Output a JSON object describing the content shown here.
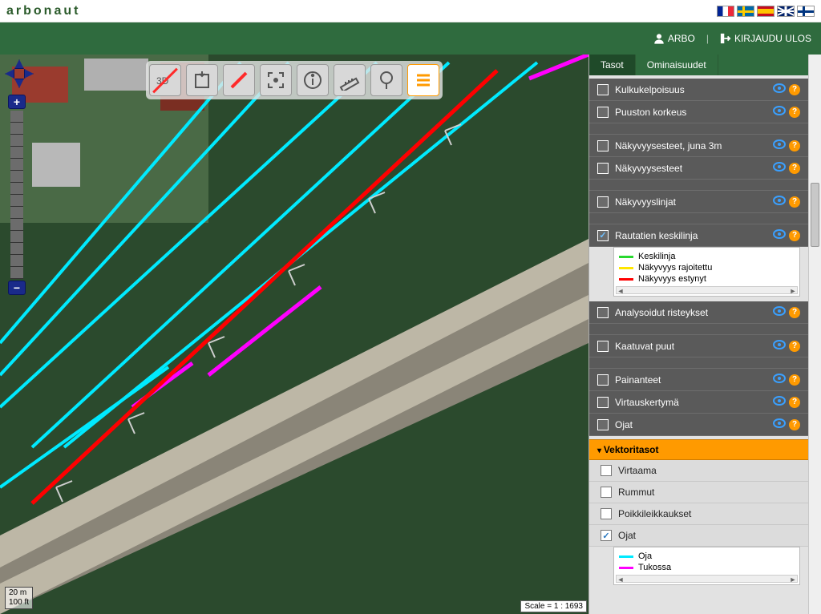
{
  "brand": "arbonaut",
  "header": {
    "user": "ARBO",
    "logout": "KIRJAUDU ULOS"
  },
  "tabs": {
    "layers": "Tasot",
    "properties": "Ominaisuudet"
  },
  "toolbar": {
    "btn3d": "3D",
    "pdf": "PDF"
  },
  "zoom": {
    "in": "+",
    "out": "−"
  },
  "layers": [
    {
      "id": "kulku",
      "label": "Kulkukelpoisuus",
      "checked": false
    },
    {
      "id": "pkork",
      "label": "Puuston korkeus",
      "checked": false
    },
    {
      "id": "nkj3",
      "label": "Näkyvyysesteet, juna 3m",
      "checked": false
    },
    {
      "id": "nke",
      "label": "Näkyvyysesteet",
      "checked": false
    },
    {
      "id": "nkl",
      "label": "Näkyvyyslinjat",
      "checked": false
    },
    {
      "id": "raut",
      "label": "Rautatien keskilinja",
      "checked": true,
      "legend": [
        {
          "color": "#29d92f",
          "label": "Keskilinja"
        },
        {
          "color": "#ffe600",
          "label": "Näkyvyys rajoitettu"
        },
        {
          "color": "#ff0000",
          "label": "Näkyvyys estynyt"
        }
      ]
    },
    {
      "id": "arist",
      "label": "Analysoidut risteykset",
      "checked": false
    },
    {
      "id": "kpuut",
      "label": "Kaatuvat puut",
      "checked": false
    },
    {
      "id": "paint",
      "label": "Painanteet",
      "checked": false
    },
    {
      "id": "virtk",
      "label": "Virtauskertymä",
      "checked": false
    },
    {
      "id": "ojat",
      "label": "Ojat",
      "checked": false
    }
  ],
  "vector_header": "Vektoritasot",
  "vector_layers": [
    {
      "id": "virtaama",
      "label": "Virtaama",
      "checked": false
    },
    {
      "id": "rummut",
      "label": "Rummut",
      "checked": false
    },
    {
      "id": "poikki",
      "label": "Poikkileikkaukset",
      "checked": false
    },
    {
      "id": "vojat",
      "label": "Ojat",
      "checked": true,
      "legend": [
        {
          "color": "#00eaff",
          "label": "Oja"
        },
        {
          "color": "#ff00ff",
          "label": "Tukossa"
        }
      ]
    }
  ],
  "scalebar": {
    "m": "20 m",
    "ft": "100 ft"
  },
  "scale_text": "Scale = 1 : 1693",
  "flags": [
    "fr",
    "se",
    "es",
    "uk",
    "fi"
  ],
  "colors": {
    "cyan": "#00eaff",
    "magenta": "#ff00ff",
    "red": "#ff0000",
    "green": "#2f6b3e",
    "orange": "#ff9a00"
  }
}
